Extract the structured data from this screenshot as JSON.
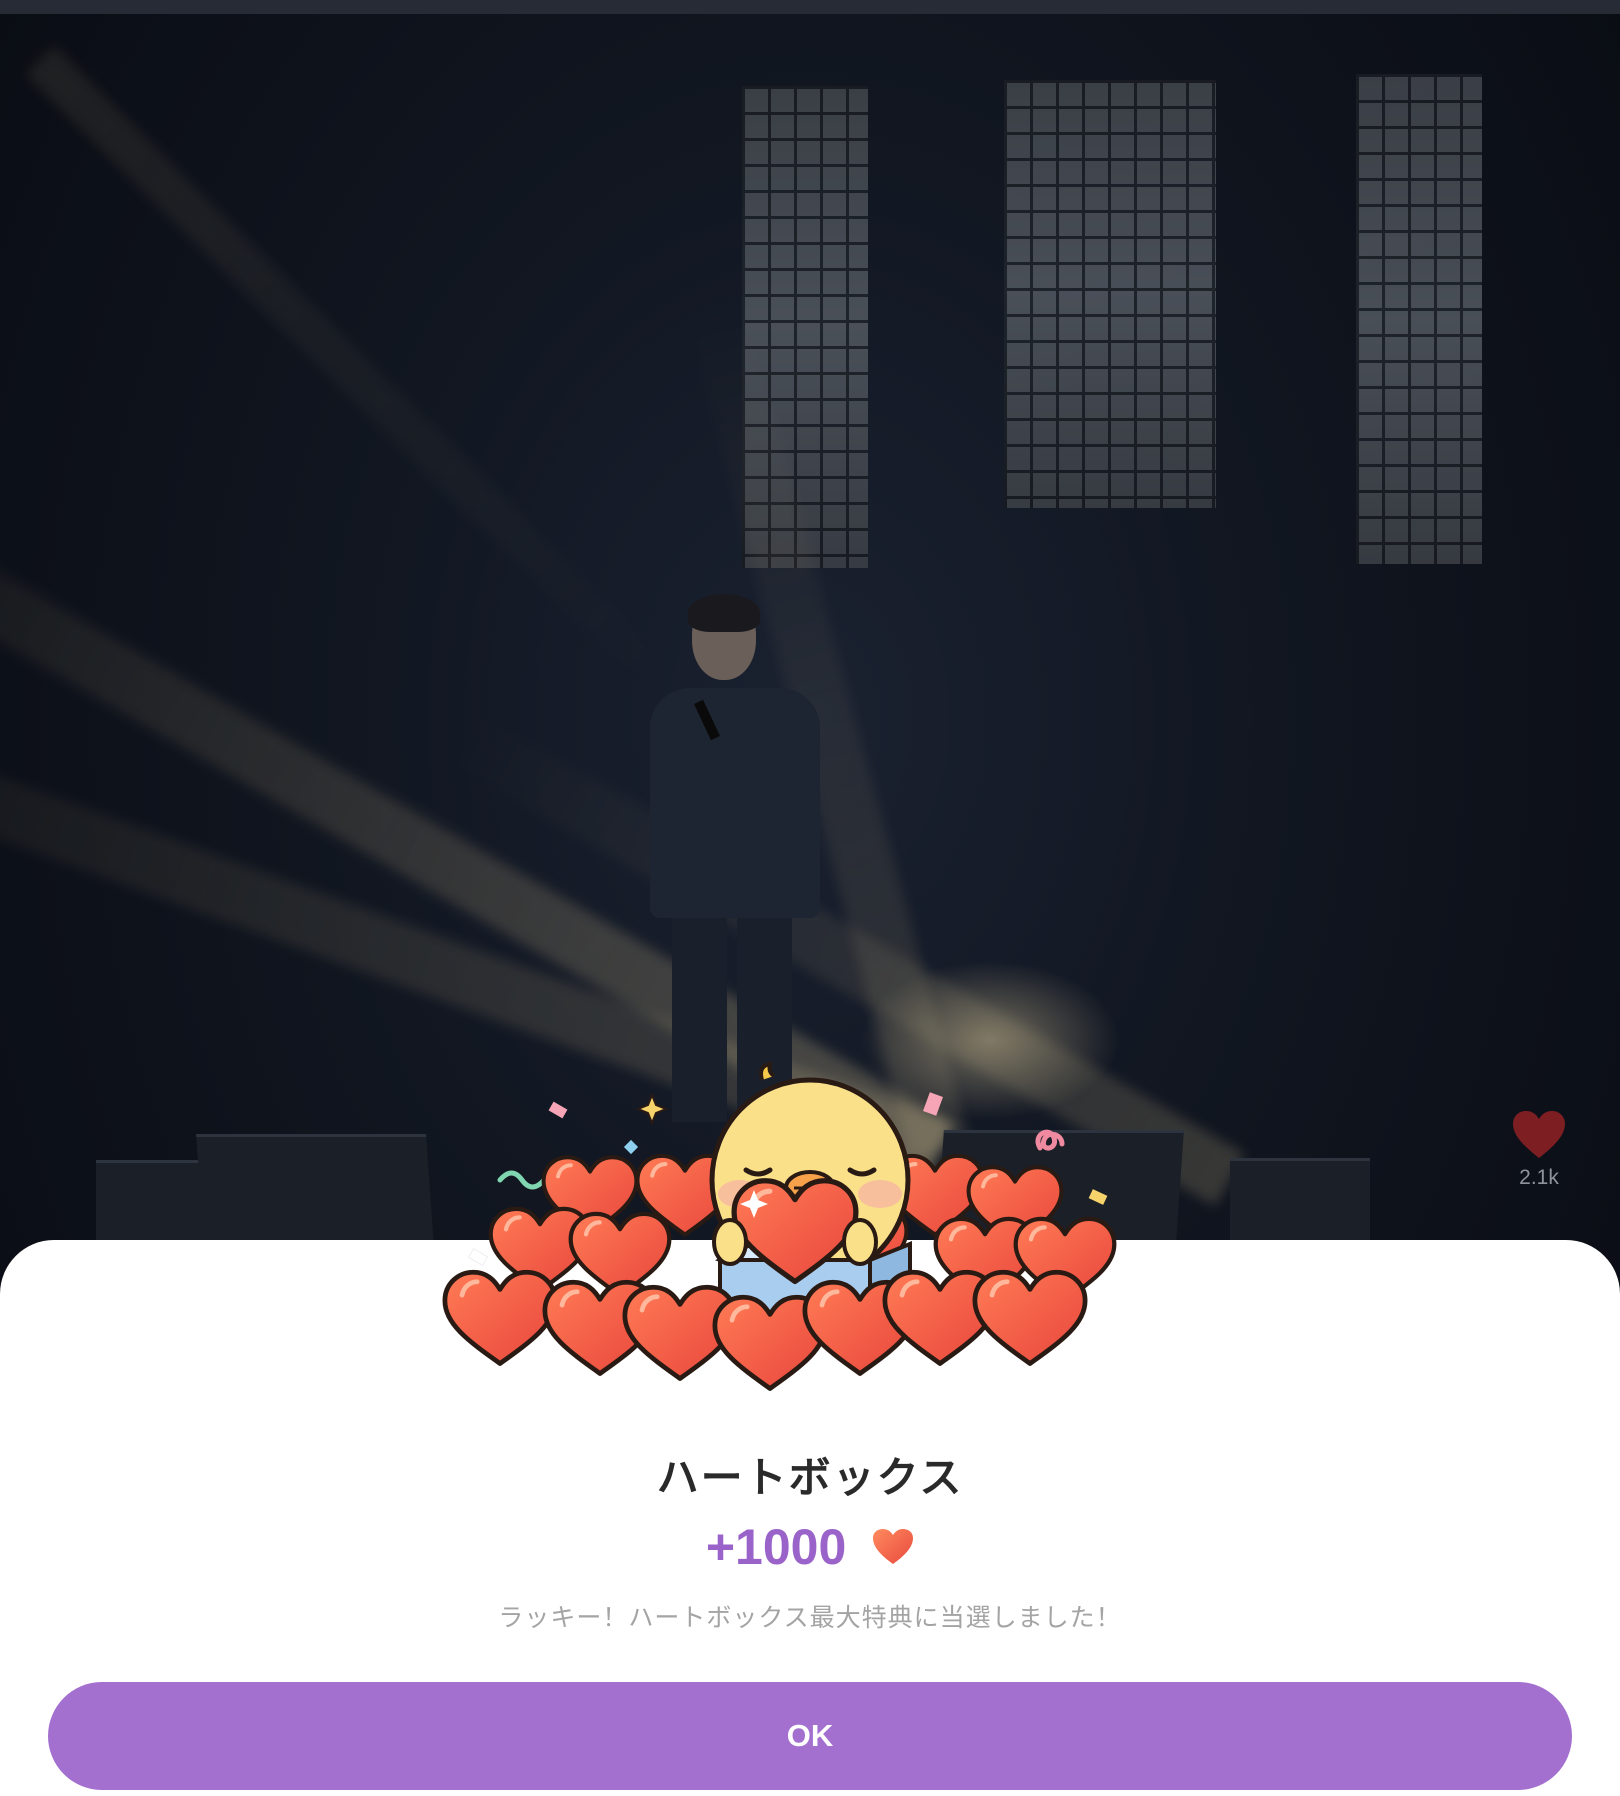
{
  "stage": {
    "description_icon": "concert-stage"
  },
  "likes": {
    "icon": "heart-icon",
    "count": "2.1k",
    "color": "#7d1f22"
  },
  "dialog": {
    "title": "ハートボックス",
    "reward_amount": "+1000",
    "reward_icon": "heart-icon",
    "message": "ラッキー！ハートボックス最大特典に当選しました！",
    "ok_label": "OK",
    "accent_color": "#a370cf",
    "reward_color": "#9a63c9"
  }
}
